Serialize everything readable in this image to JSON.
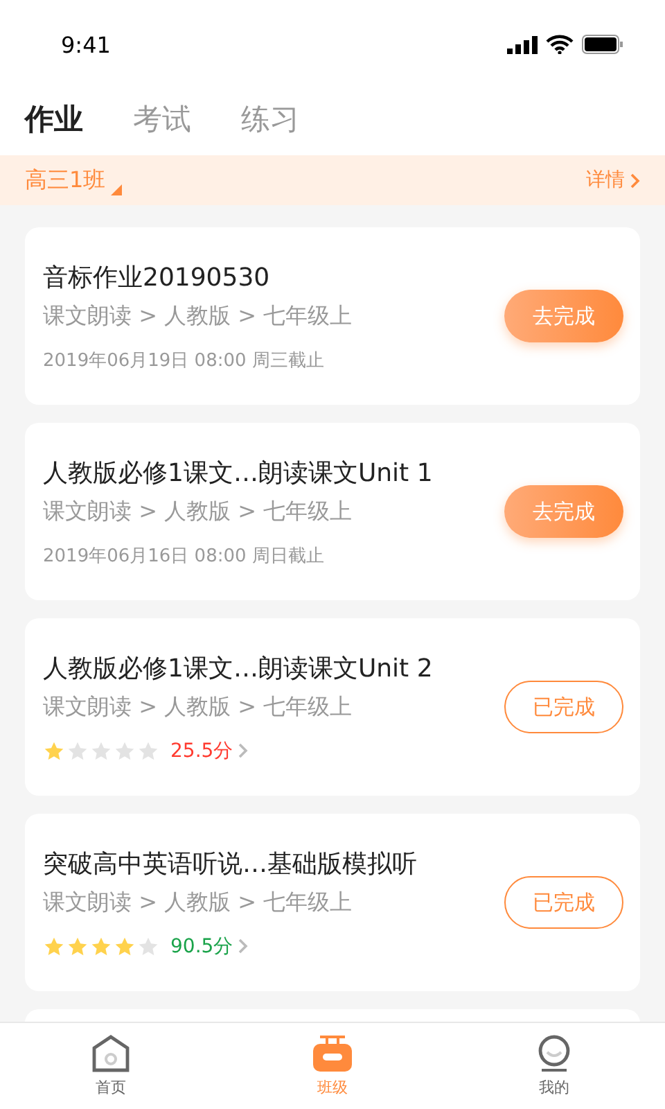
{
  "status_bar": {
    "time": "9:41"
  },
  "tabs": [
    {
      "label": "作业",
      "selected": true
    },
    {
      "label": "考试",
      "selected": false
    },
    {
      "label": "练习",
      "selected": false
    }
  ],
  "class_bar": {
    "class_name": "高三1班",
    "details": "详情"
  },
  "tasks": [
    {
      "kind": "todo",
      "title": "音标作业20190530",
      "path": "课文朗读 > 人教版 > 七年级上",
      "deadline": "2019年06月19日 08:00 周三截止",
      "button": "去完成"
    },
    {
      "kind": "todo",
      "title": "人教版必修1课文…朗读课文Unit 1",
      "path": "课文朗读 > 人教版 > 七年级上",
      "deadline": "2019年06月16日 08:00 周日截止",
      "button": "去完成"
    },
    {
      "kind": "done",
      "title": "人教版必修1课文…朗读课文Unit 2",
      "path": "课文朗读 > 人教版 > 七年级上",
      "stars": 1,
      "score": "25.5分",
      "color": "#ff3b30",
      "button": "已完成"
    },
    {
      "kind": "done",
      "title": "突破高中英语听说…基础版模拟听",
      "path": "课文朗读 > 人教版 > 七年级上",
      "stars": 4,
      "score": "90.5分",
      "color": "#1aa34a",
      "button": "已完成"
    }
  ],
  "nav": [
    {
      "label": "首页",
      "selected": false
    },
    {
      "label": "班级",
      "selected": true
    },
    {
      "label": "我的",
      "selected": false
    }
  ]
}
